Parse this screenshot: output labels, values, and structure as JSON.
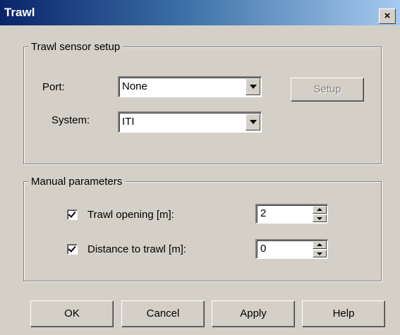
{
  "window": {
    "title": "Trawl",
    "close_symbol": "×"
  },
  "sensor_setup": {
    "group_title": "Trawl sensor setup",
    "port_label": "Port:",
    "port_value": "None",
    "system_label": "System:",
    "system_value": "ITI",
    "setup_button": "Setup",
    "setup_enabled": false
  },
  "manual_parameters": {
    "group_title": "Manual parameters",
    "trawl_opening": {
      "label": "Trawl opening [m]:",
      "checked": true,
      "value": "2"
    },
    "distance_to_trawl": {
      "label": "Distance to trawl [m]:",
      "checked": true,
      "value": "0"
    }
  },
  "buttons": {
    "ok": "OK",
    "cancel": "Cancel",
    "apply": "Apply",
    "help": "Help"
  },
  "colors": {
    "dialog_bg": "#d4d0c8",
    "titlebar_start": "#0a246a",
    "titlebar_end": "#a6caf0",
    "disabled_text": "#808080"
  }
}
